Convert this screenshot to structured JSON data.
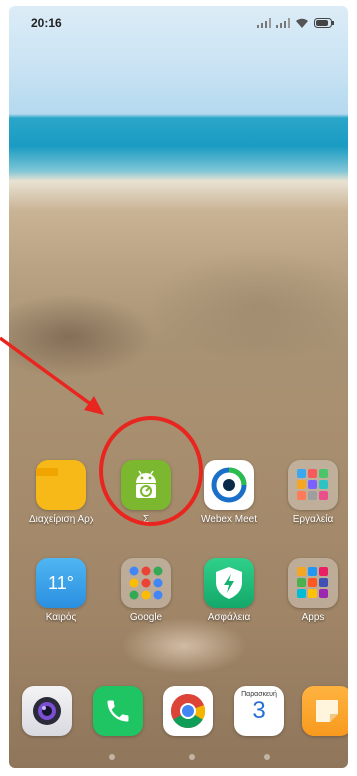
{
  "status_bar": {
    "time": "20:16"
  },
  "home_apps": [
    {
      "label": "Διαχείριση Αρχείων",
      "icon": "folder-icon"
    },
    {
      "label": "Σ",
      "icon": "android-app-icon"
    },
    {
      "label": "Webex Meet",
      "icon": "webex-icon"
    },
    {
      "label": "Εργαλεία",
      "icon": "tools-folder-icon"
    },
    {
      "label": "Καιρός",
      "icon": "weather-icon",
      "temp": "11°"
    },
    {
      "label": "Google",
      "icon": "google-folder-icon"
    },
    {
      "label": "Ασφάλεια",
      "icon": "security-shield-icon"
    },
    {
      "label": "Apps",
      "icon": "apps-folder-icon"
    }
  ],
  "dock": [
    {
      "icon": "camera-icon"
    },
    {
      "icon": "phone-icon"
    },
    {
      "icon": "chrome-icon"
    },
    {
      "icon": "calendar-icon",
      "day_name": "Παρασκευή",
      "day_number": "3"
    },
    {
      "icon": "notes-icon"
    }
  ],
  "colors": {
    "annotation": "#e8261f"
  }
}
